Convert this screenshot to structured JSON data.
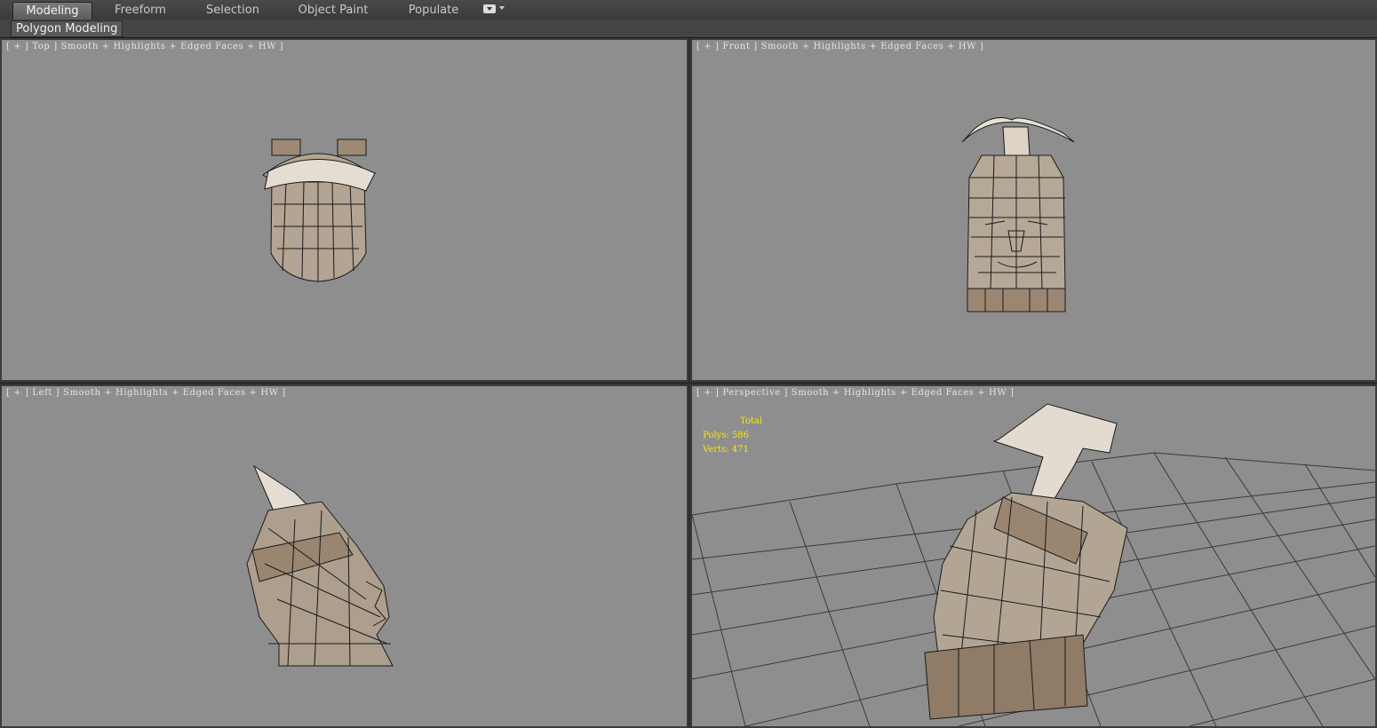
{
  "ribbon": {
    "tabs": [
      {
        "label": "Modeling",
        "active": true
      },
      {
        "label": "Freeform",
        "active": false
      },
      {
        "label": "Selection",
        "active": false
      },
      {
        "label": "Object Paint",
        "active": false
      },
      {
        "label": "Populate",
        "active": false
      }
    ],
    "panel_label": "Polygon Modeling"
  },
  "viewports": {
    "top": {
      "label": "[ + ] Top ] Smooth + Highlights + Edged Faces + HW ]"
    },
    "front": {
      "label": "[ + ] Front ] Smooth + Highlights + Edged Faces + HW ]"
    },
    "left": {
      "label": "[ + ] Left ] Smooth + Highlights + Edged Faces + HW ]"
    },
    "perspective": {
      "label": "[ + ] Perspective ] Smooth + Highlights + Edged Faces + HW ]"
    }
  },
  "stats": {
    "total_label": "Total",
    "polys_label": "Polys:",
    "polys_value": "586",
    "verts_label": "Verts:",
    "verts_value": "471"
  },
  "colors": {
    "viewport_bg": "#8e8e8e",
    "stats_text": "#ffe600",
    "model_stone": "#b8aa9a",
    "grid_line": "#3a3a3a"
  }
}
